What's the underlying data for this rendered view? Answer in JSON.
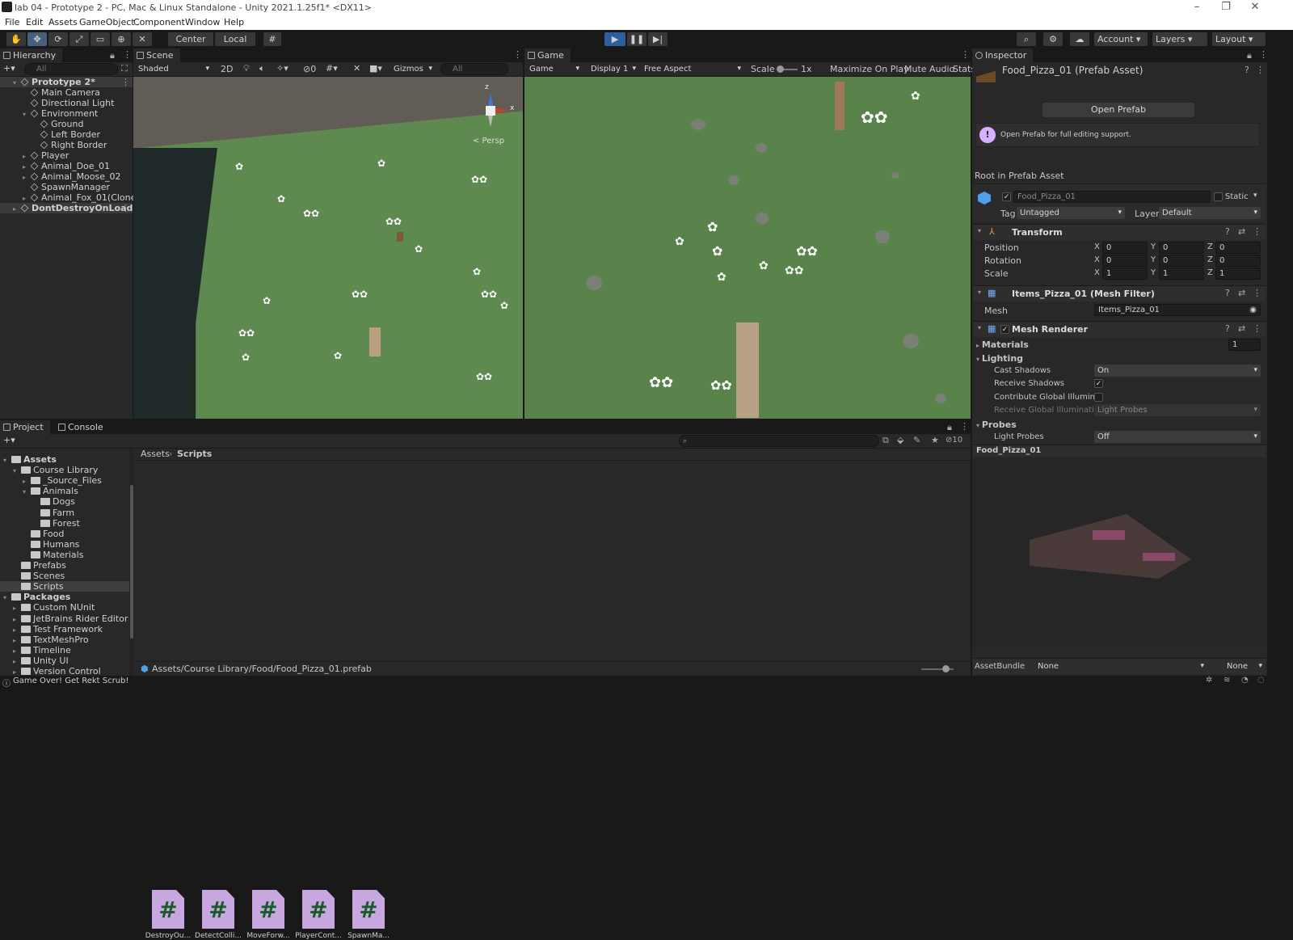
{
  "window": {
    "title": "lab 04 - Prototype 2 - PC, Mac & Linux Standalone - Unity 2021.1.25f1* <DX11>"
  },
  "menu": [
    "File",
    "Edit",
    "Assets",
    "GameObject",
    "Component",
    "Window",
    "Help"
  ],
  "toolbar": {
    "pivot": "Center",
    "space": "Local",
    "account": "Account",
    "layers": "Layers",
    "layout": "Layout"
  },
  "hierarchy": {
    "tab": "Hierarchy",
    "search_placeholder": "All",
    "items": [
      {
        "label": "Prototype 2*",
        "depth": 0,
        "fold": "▾",
        "scene": true
      },
      {
        "label": "Main Camera",
        "depth": 1,
        "fold": ""
      },
      {
        "label": "Directional Light",
        "depth": 1,
        "fold": ""
      },
      {
        "label": "Environment",
        "depth": 1,
        "fold": "▾"
      },
      {
        "label": "Ground",
        "depth": 2,
        "fold": ""
      },
      {
        "label": "Left Border",
        "depth": 2,
        "fold": ""
      },
      {
        "label": "Right Border",
        "depth": 2,
        "fold": ""
      },
      {
        "label": "Player",
        "depth": 1,
        "fold": "▸"
      },
      {
        "label": "Animal_Doe_01",
        "depth": 1,
        "fold": "▸"
      },
      {
        "label": "Animal_Moose_02",
        "depth": 1,
        "fold": "▸"
      },
      {
        "label": "SpawnManager",
        "depth": 1,
        "fold": ""
      },
      {
        "label": "Animal_Fox_01(Clone)",
        "depth": 1,
        "fold": "▸"
      },
      {
        "label": "DontDestroyOnLoad",
        "depth": 0,
        "fold": "▸",
        "scene": true
      }
    ]
  },
  "scene": {
    "tab": "Scene",
    "shading": "Shaded",
    "mode2d": "2D",
    "hidden_count": "0",
    "gizmos": "Gizmos",
    "search_placeholder": "All",
    "persp": "< Persp",
    "axis_x": "x",
    "axis_z": "z"
  },
  "game": {
    "tab": "Game",
    "view": "Game",
    "display": "Display 1",
    "aspect": "Free Aspect",
    "scale_label": "Scale",
    "scale_value": "1x",
    "maximize": "Maximize On Play",
    "mute": "Mute Audio",
    "stats": "Stats"
  },
  "inspector": {
    "tab": "Inspector",
    "asset_title": "Food_Pizza_01 (Prefab Asset)",
    "open_prefab": "Open Prefab",
    "help_text": "Open Prefab for full editing support.",
    "root_label": "Root in Prefab Asset",
    "object_name": "Food_Pizza_01",
    "static_label": "Static",
    "tag_label": "Tag",
    "tag_value": "Untagged",
    "layer_label": "Layer",
    "layer_value": "Default",
    "transform": {
      "title": "Transform",
      "rows": [
        {
          "label": "Position",
          "x": "0",
          "y": "0",
          "z": "0"
        },
        {
          "label": "Rotation",
          "x": "0",
          "y": "0",
          "z": "0"
        },
        {
          "label": "Scale",
          "x": "1",
          "y": "1",
          "z": "1"
        }
      ],
      "axis_x": "X",
      "axis_y": "Y",
      "axis_z": "Z"
    },
    "mesh_filter": {
      "title": "Items_Pizza_01 (Mesh Filter)",
      "mesh_label": "Mesh",
      "mesh_value": "Items_Pizza_01"
    },
    "mesh_renderer": {
      "title": "Mesh Renderer",
      "materials_label": "Materials",
      "materials_count": "1",
      "lighting_label": "Lighting",
      "cast_shadows_label": "Cast Shadows",
      "cast_shadows_value": "On",
      "receive_shadows_label": "Receive Shadows",
      "contribute_gi_label": "Contribute Global Illuminat",
      "receive_gi_label": "Receive Global Illuminatior",
      "receive_gi_value": "Light Probes",
      "probes_label": "Probes",
      "light_probes_label": "Light Probes",
      "light_probes_value": "Off"
    },
    "preview_title": "Food_Pizza_01",
    "assetbundle_label": "AssetBundle",
    "assetbundle_value": "None",
    "assetbundle_variant": "None"
  },
  "project": {
    "tab_project": "Project",
    "tab_console": "Console",
    "hidden_packages": "10",
    "breadcrumb": [
      "Assets",
      "Scripts"
    ],
    "tree": [
      {
        "label": "Assets",
        "depth": 0,
        "fold": "▾",
        "bold": true
      },
      {
        "label": "Course Library",
        "depth": 1,
        "fold": "▾"
      },
      {
        "label": "_Source_Files",
        "depth": 2,
        "fold": "▸"
      },
      {
        "label": "Animals",
        "depth": 2,
        "fold": "▾"
      },
      {
        "label": "Dogs",
        "depth": 3,
        "fold": ""
      },
      {
        "label": "Farm",
        "depth": 3,
        "fold": ""
      },
      {
        "label": "Forest",
        "depth": 3,
        "fold": ""
      },
      {
        "label": "Food",
        "depth": 2,
        "fold": ""
      },
      {
        "label": "Humans",
        "depth": 2,
        "fold": ""
      },
      {
        "label": "Materials",
        "depth": 2,
        "fold": ""
      },
      {
        "label": "Prefabs",
        "depth": 1,
        "fold": ""
      },
      {
        "label": "Scenes",
        "depth": 1,
        "fold": ""
      },
      {
        "label": "Scripts",
        "depth": 1,
        "fold": "",
        "selected": true
      },
      {
        "label": "Packages",
        "depth": 0,
        "fold": "▾",
        "bold": true
      },
      {
        "label": "Custom NUnit",
        "depth": 1,
        "fold": "▸"
      },
      {
        "label": "JetBrains Rider Editor",
        "depth": 1,
        "fold": "▸"
      },
      {
        "label": "Test Framework",
        "depth": 1,
        "fold": "▸"
      },
      {
        "label": "TextMeshPro",
        "depth": 1,
        "fold": "▸"
      },
      {
        "label": "Timeline",
        "depth": 1,
        "fold": "▸"
      },
      {
        "label": "Unity UI",
        "depth": 1,
        "fold": "▸"
      },
      {
        "label": "Version Control",
        "depth": 1,
        "fold": "▸"
      }
    ],
    "scripts": [
      {
        "name": "DestroyOu...",
        "glyph": "#"
      },
      {
        "name": "DetectColli...",
        "glyph": "#"
      },
      {
        "name": "MoveForw...",
        "glyph": "#"
      },
      {
        "name": "PlayerCont...",
        "glyph": "#"
      },
      {
        "name": "SpawnMa...",
        "glyph": "#"
      }
    ],
    "selected_path": "Assets/Course Library/Food/Food_Pizza_01.prefab"
  },
  "status": {
    "message": "Game Over! Get Rekt Scrub!"
  },
  "colors": {
    "accent": "#2f5e9c",
    "selection": "#2c5d87",
    "grass": "#5f8a4f",
    "script_icon": "#c8a6e0"
  }
}
